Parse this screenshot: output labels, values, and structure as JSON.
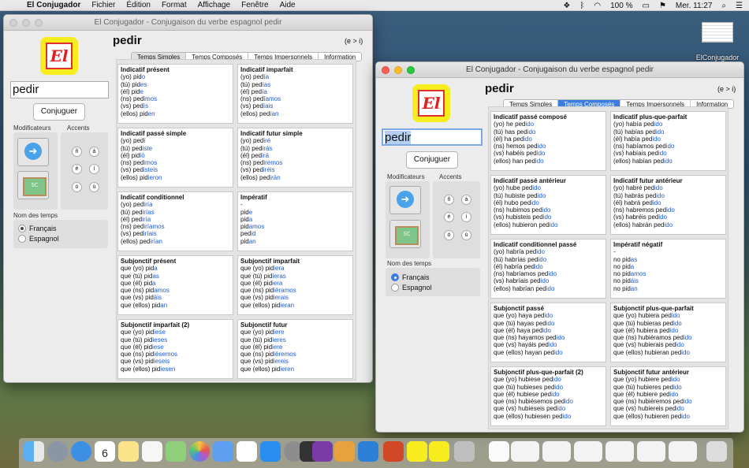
{
  "menubar": {
    "app": "El Conjugador",
    "items": [
      "Fichier",
      "Édition",
      "Format",
      "Affichage",
      "Fenêtre",
      "Aide"
    ],
    "battery": "100 %",
    "clock": "Mer. 11:27"
  },
  "desktop_icon": {
    "label": "ElConjugador"
  },
  "window1": {
    "title": "El Conjugador - Conjugaison du verbe espagnol pedir",
    "logo_text": "El",
    "verb_input": "pedir",
    "conjuguer_label": "Conjuguer",
    "modificateurs_label": "Modificateurs",
    "accents_label": "Accents",
    "accent_keys": [
      "ñ",
      "á",
      "é",
      "í",
      "ó",
      "ú"
    ],
    "nom_des_temps_label": "Nom des temps",
    "radio_francais": "Français",
    "radio_espagnol": "Espagnol",
    "verb_title": "pedir",
    "pattern": "(e > i)",
    "tabs": [
      "Temps Simples",
      "Temps Composés",
      "Temps Impersonnels",
      "Information"
    ],
    "boxes": [
      {
        "title": "Indicatif présent",
        "rows": [
          [
            "(yo) pid",
            "o"
          ],
          [
            "(tú) pid",
            "es"
          ],
          [
            "(él) pid",
            "e"
          ],
          [
            "(ns) ped",
            "imos"
          ],
          [
            "(vs) ped",
            "ís"
          ],
          [
            "(ellos) pid",
            "en"
          ]
        ]
      },
      {
        "title": "Indicatif imparfait",
        "rows": [
          [
            "(yo) ped",
            "ía"
          ],
          [
            "(tú) ped",
            "ías"
          ],
          [
            "(él) ped",
            "ía"
          ],
          [
            "(ns) ped",
            "íamos"
          ],
          [
            "(vs) ped",
            "íais"
          ],
          [
            "(ellos) ped",
            "ían"
          ]
        ]
      },
      {
        "title": "Indicatif passé simple",
        "rows": [
          [
            "(yo) ped",
            "í"
          ],
          [
            "(tú) ped",
            "iste"
          ],
          [
            "(él) pid",
            "ió"
          ],
          [
            "(ns) ped",
            "imos"
          ],
          [
            "(vs) ped",
            "isteis"
          ],
          [
            "(ellos) pid",
            "ieron"
          ]
        ]
      },
      {
        "title": "Indicatif futur simple",
        "rows": [
          [
            "(yo) ped",
            "iré"
          ],
          [
            "(tú) ped",
            "irás"
          ],
          [
            "(él) ped",
            "irá"
          ],
          [
            "(ns) ped",
            "iremos"
          ],
          [
            "(vs) ped",
            "iréis"
          ],
          [
            "(ellos) ped",
            "irán"
          ]
        ]
      },
      {
        "title": "Indicatif conditionnel",
        "rows": [
          [
            "(yo) ped",
            "iría"
          ],
          [
            "(tú) ped",
            "irías"
          ],
          [
            "(él) ped",
            "iría"
          ],
          [
            "(ns) ped",
            "iríamos"
          ],
          [
            "(vs) ped",
            "iríais"
          ],
          [
            "(ellos) ped",
            "irían"
          ]
        ]
      },
      {
        "title": "Impératif",
        "rows": [
          [
            "-",
            ""
          ],
          [
            "pid",
            "e"
          ],
          [
            "pid",
            "a"
          ],
          [
            "pid",
            "amos"
          ],
          [
            "ped",
            "id"
          ],
          [
            "pid",
            "an"
          ]
        ]
      },
      {
        "title": "Subjonctif présent",
        "rows": [
          [
            "que (yo) pid",
            "a"
          ],
          [
            "que (tú) pid",
            "as"
          ],
          [
            "que (él) pid",
            "a"
          ],
          [
            "que (ns) pid",
            "amos"
          ],
          [
            "que (vs) pid",
            "áis"
          ],
          [
            "que (ellos) pid",
            "an"
          ]
        ]
      },
      {
        "title": "Subjonctif imparfait",
        "rows": [
          [
            "que (yo) pid",
            "iera"
          ],
          [
            "que (tú) pid",
            "ieras"
          ],
          [
            "que (él) pid",
            "iera"
          ],
          [
            "que (ns) pid",
            "iéramos"
          ],
          [
            "que (vs) pid",
            "ierais"
          ],
          [
            "que (ellos) pid",
            "ieran"
          ]
        ]
      },
      {
        "title": "Subjonctif imparfait (2)",
        "rows": [
          [
            "que (yo) pid",
            "iese"
          ],
          [
            "que (tú) pid",
            "ieses"
          ],
          [
            "que (él) pid",
            "iese"
          ],
          [
            "que (ns) pid",
            "iésemos"
          ],
          [
            "que (vs) pid",
            "ieseis"
          ],
          [
            "que (ellos) pid",
            "iesen"
          ]
        ]
      },
      {
        "title": "Subjonctif futur",
        "rows": [
          [
            "que (yo) pid",
            "iere"
          ],
          [
            "que (tú) pid",
            "ieres"
          ],
          [
            "que (él) pid",
            "iere"
          ],
          [
            "que (ns) pid",
            "iéremos"
          ],
          [
            "que (vs) pid",
            "iereis"
          ],
          [
            "que (ellos) pid",
            "ieren"
          ]
        ]
      }
    ]
  },
  "window2": {
    "title": "El Conjugador - Conjugaison du verbe espagnol pedir",
    "logo_text": "El",
    "verb_input": "pedir",
    "conjuguer_label": "Conjuguer",
    "modificateurs_label": "Modificateurs",
    "accents_label": "Accents",
    "accent_keys": [
      "ñ",
      "á",
      "é",
      "í",
      "ó",
      "ú"
    ],
    "nom_des_temps_label": "Nom des temps",
    "radio_francais": "Français",
    "radio_espagnol": "Espagnol",
    "verb_title": "pedir",
    "pattern": "(e > i)",
    "tabs": [
      "Temps Simples",
      "Temps Composés",
      "Temps Impersonnels",
      "Information"
    ],
    "boxes": [
      {
        "title": "Indicatif passé composé",
        "rows": [
          [
            "(yo) he ped",
            "ido"
          ],
          [
            "(tú) has ped",
            "ido"
          ],
          [
            "(él) ha ped",
            "ido"
          ],
          [
            "(ns) hemos ped",
            "ido"
          ],
          [
            "(vs) habéis ped",
            "ido"
          ],
          [
            "(ellos) han ped",
            "ido"
          ]
        ]
      },
      {
        "title": "Indicatif plus-que-parfait",
        "rows": [
          [
            "(yo) había ped",
            "ido"
          ],
          [
            "(tú) habías ped",
            "ido"
          ],
          [
            "(él) había ped",
            "ido"
          ],
          [
            "(ns) habíamos ped",
            "ido"
          ],
          [
            "(vs) habíais ped",
            "ido"
          ],
          [
            "(ellos) habían ped",
            "ido"
          ]
        ]
      },
      {
        "title": "Indicatif passé antérieur",
        "rows": [
          [
            "(yo) hube ped",
            "ido"
          ],
          [
            "(tú) hubiste ped",
            "ido"
          ],
          [
            "(él) hubo ped",
            "ido"
          ],
          [
            "(ns) hubimos ped",
            "ido"
          ],
          [
            "(vs) hubisteis ped",
            "ido"
          ],
          [
            "(ellos) hubieron ped",
            "ido"
          ]
        ]
      },
      {
        "title": "Indicatif futur antérieur",
        "rows": [
          [
            "(yo) habré ped",
            "ido"
          ],
          [
            "(tú) habrás ped",
            "ido"
          ],
          [
            "(él) habrá ped",
            "ido"
          ],
          [
            "(ns) habremos ped",
            "ido"
          ],
          [
            "(vs) habréis ped",
            "ido"
          ],
          [
            "(ellos) habrán ped",
            "ido"
          ]
        ]
      },
      {
        "title": "Indicatif conditionnel passé",
        "rows": [
          [
            "(yo) habría ped",
            "ido"
          ],
          [
            "(tú) habrías ped",
            "ido"
          ],
          [
            "(él) habría ped",
            "ido"
          ],
          [
            "(ns) habríamos ped",
            "ido"
          ],
          [
            "(vs) habríais ped",
            "ido"
          ],
          [
            "(ellos) habrían ped",
            "ido"
          ]
        ]
      },
      {
        "title": "Impératif négatif",
        "rows": [
          [
            "-",
            ""
          ],
          [
            "no pid",
            "as"
          ],
          [
            "no pid",
            "a"
          ],
          [
            "no pid",
            "amos"
          ],
          [
            "no pid",
            "áis"
          ],
          [
            "no pid",
            "an"
          ]
        ]
      },
      {
        "title": "Subjonctif passé",
        "rows": [
          [
            "que (yo) haya ped",
            "ido"
          ],
          [
            "que (tú) hayas ped",
            "ido"
          ],
          [
            "que (él) haya ped",
            "ido"
          ],
          [
            "que (ns) hayamos ped",
            "ido"
          ],
          [
            "que (vs) hayáis ped",
            "ido"
          ],
          [
            "que (ellos) hayan ped",
            "ido"
          ]
        ]
      },
      {
        "title": "Subjonctif plus-que-parfait",
        "rows": [
          [
            "que (yo) hubiera ped",
            "ido"
          ],
          [
            "que (tú) hubieras ped",
            "ido"
          ],
          [
            "que (él) hubiera ped",
            "ido"
          ],
          [
            "que (ns) hubiéramos ped",
            "ido"
          ],
          [
            "que (vs) hubierais ped",
            "ido"
          ],
          [
            "que (ellos) hubieran ped",
            "ido"
          ]
        ]
      },
      {
        "title": "Subjonctif plus-que-parfait (2)",
        "rows": [
          [
            "que (yo) hubiese ped",
            "ido"
          ],
          [
            "que (tú) hubieses ped",
            "ido"
          ],
          [
            "que (él) hubiese ped",
            "ido"
          ],
          [
            "que (ns) hubiésemos ped",
            "ido"
          ],
          [
            "que (vs) hubieseis ped",
            "ido"
          ],
          [
            "que (ellos) hubiesen ped",
            "ido"
          ]
        ]
      },
      {
        "title": "Subjonctif futur antérieur",
        "rows": [
          [
            "que (yo) hubiere ped",
            "ido"
          ],
          [
            "que (tú) hubieres ped",
            "ido"
          ],
          [
            "que (él) hubiere ped",
            "ido"
          ],
          [
            "que (ns) hubiéremos ped",
            "ido"
          ],
          [
            "que (vs) hubiereis ped",
            "ido"
          ],
          [
            "que (ellos) hubieren ped",
            "ido"
          ]
        ]
      }
    ]
  },
  "dock": {
    "calendar_day": "6",
    "calendar_month": "JUIN"
  }
}
